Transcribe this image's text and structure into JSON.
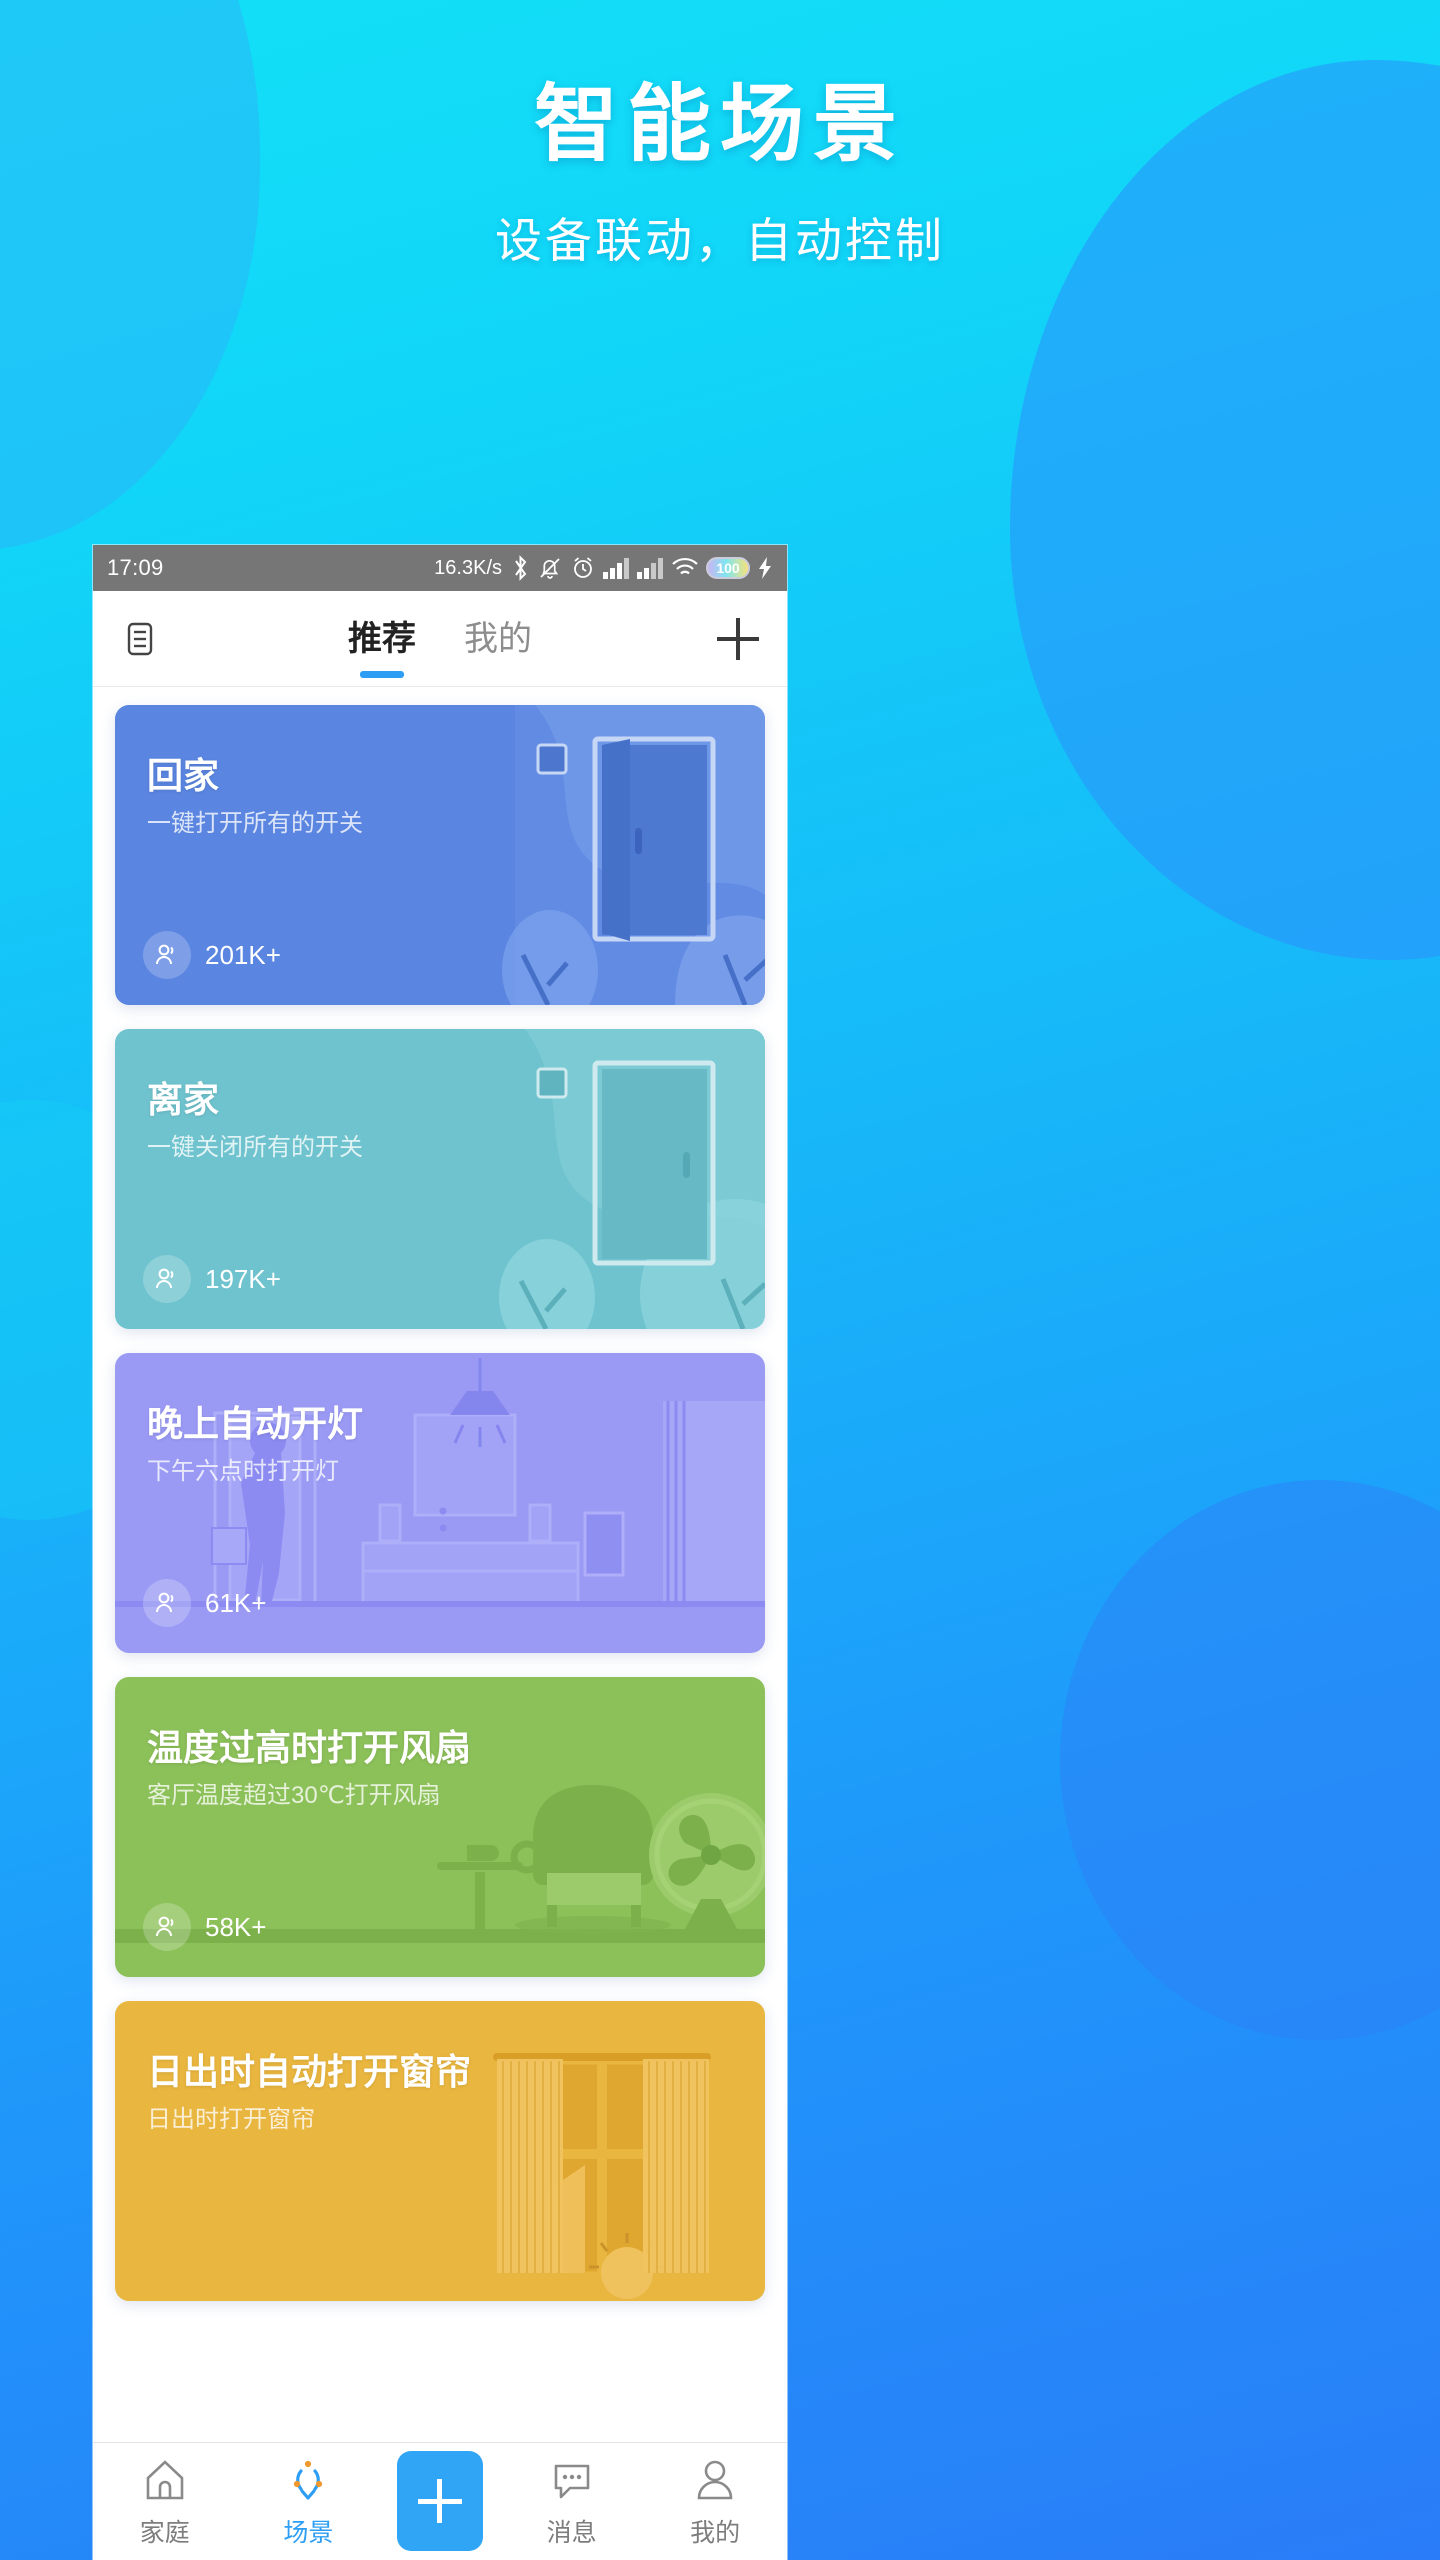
{
  "promo": {
    "title": "智能场景",
    "subtitle": "设备联动，自动控制",
    "bg_gradient_from": "#13E0F7",
    "bg_gradient_to": "#2A7CF8"
  },
  "statusbar": {
    "time": "17:09",
    "network_speed": "16.3K/s",
    "icons": [
      "bluetooth-icon",
      "bell-mute-icon",
      "alarm-clock-icon",
      "signal-bars-icon",
      "signal-bars-icon",
      "wifi-icon"
    ],
    "battery_level": "100",
    "charging": true
  },
  "navbar": {
    "menu_icon": "list-menu-icon",
    "tabs": [
      {
        "label": "推荐",
        "active": true
      },
      {
        "label": "我的",
        "active": false
      }
    ],
    "add_icon": "plus-icon",
    "active_indicator_color": "#2E9EF4"
  },
  "scenes": [
    {
      "title": "回家",
      "desc": "一键打开所有的开关",
      "count": "201K+",
      "color": "#5A85E0",
      "art": "door-open"
    },
    {
      "title": "离家",
      "desc": "一键关闭所有的开关",
      "count": "197K+",
      "color": "#6FC3CE",
      "art": "door-closed"
    },
    {
      "title": "晚上自动开灯",
      "desc": "下午六点时打开灯",
      "count": "61K+",
      "color": "#9A9AF5",
      "art": "living-room"
    },
    {
      "title": "温度过高时打开风扇",
      "desc": "客厅温度超过30℃打开风扇",
      "count": "58K+",
      "color": "#8CC059",
      "art": "sofa-fan"
    },
    {
      "title": "日出时自动打开窗帘",
      "desc": "日出时打开窗帘",
      "count": "",
      "color": "#E9B63F",
      "art": "window-curtain"
    }
  ],
  "tabbar": {
    "items": [
      {
        "label": "家庭",
        "icon": "home-icon",
        "active": false
      },
      {
        "label": "场景",
        "icon": "scene-icon",
        "active": true
      },
      {
        "label": "消息",
        "icon": "message-icon",
        "active": false
      },
      {
        "label": "我的",
        "icon": "person-icon",
        "active": false
      }
    ],
    "add_button_icon": "plus-icon",
    "add_button_color": "#30A5F5",
    "active_color": "#2E9EF4"
  }
}
